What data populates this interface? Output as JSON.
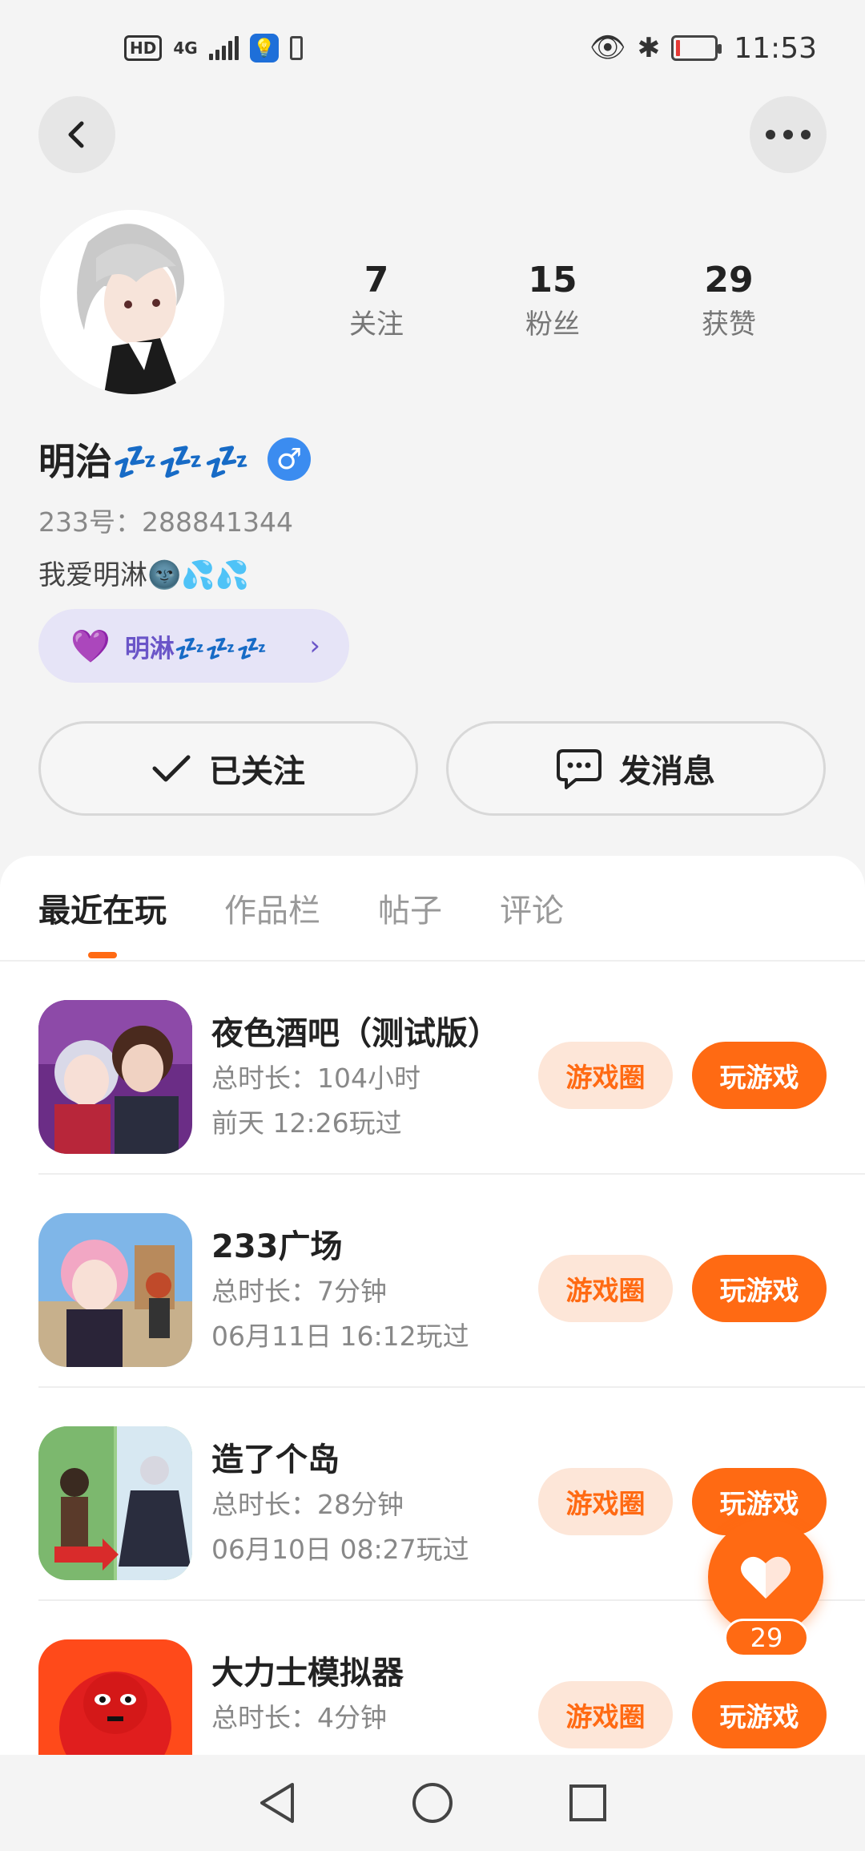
{
  "status_bar": {
    "hd": "HD",
    "network": "4G",
    "time": "11:53"
  },
  "profile": {
    "name": "明治💤💤💤",
    "gender_symbol": "♂",
    "uid": "233号：288841344",
    "bio": "我爱明淋🌚💦💦",
    "relation_tag": "明淋💤💤💤",
    "stats": [
      {
        "value": "7",
        "label": "关注"
      },
      {
        "value": "15",
        "label": "粉丝"
      },
      {
        "value": "29",
        "label": "获赞"
      }
    ],
    "follow_label": "已关注",
    "message_label": "发消息"
  },
  "tabs": [
    "最近在玩",
    "作品栏",
    "帖子",
    "评论"
  ],
  "active_tab": "最近在玩",
  "games": [
    {
      "title": "夜色酒吧（测试版）",
      "duration": "总时长：104小时",
      "last_played": "前天 12:26玩过"
    },
    {
      "title": "233广场",
      "duration": "总时长：7分钟",
      "last_played": "06月11日 16:12玩过"
    },
    {
      "title": "造了个岛",
      "duration": "总时长：28分钟",
      "last_played": "06月10日 08:27玩过"
    },
    {
      "title": "大力士模拟器",
      "duration": "总时长：4分钟",
      "last_played": ""
    }
  ],
  "buttons": {
    "circle": "游戏圈",
    "play": "玩游戏"
  },
  "like_count": "29",
  "colors": {
    "accent": "#ff6a13",
    "accent_light": "#fde6d8",
    "relation_bg": "#e6e4f7",
    "relation_text": "#6a55c8",
    "gender_blue": "#3b8cf0"
  }
}
